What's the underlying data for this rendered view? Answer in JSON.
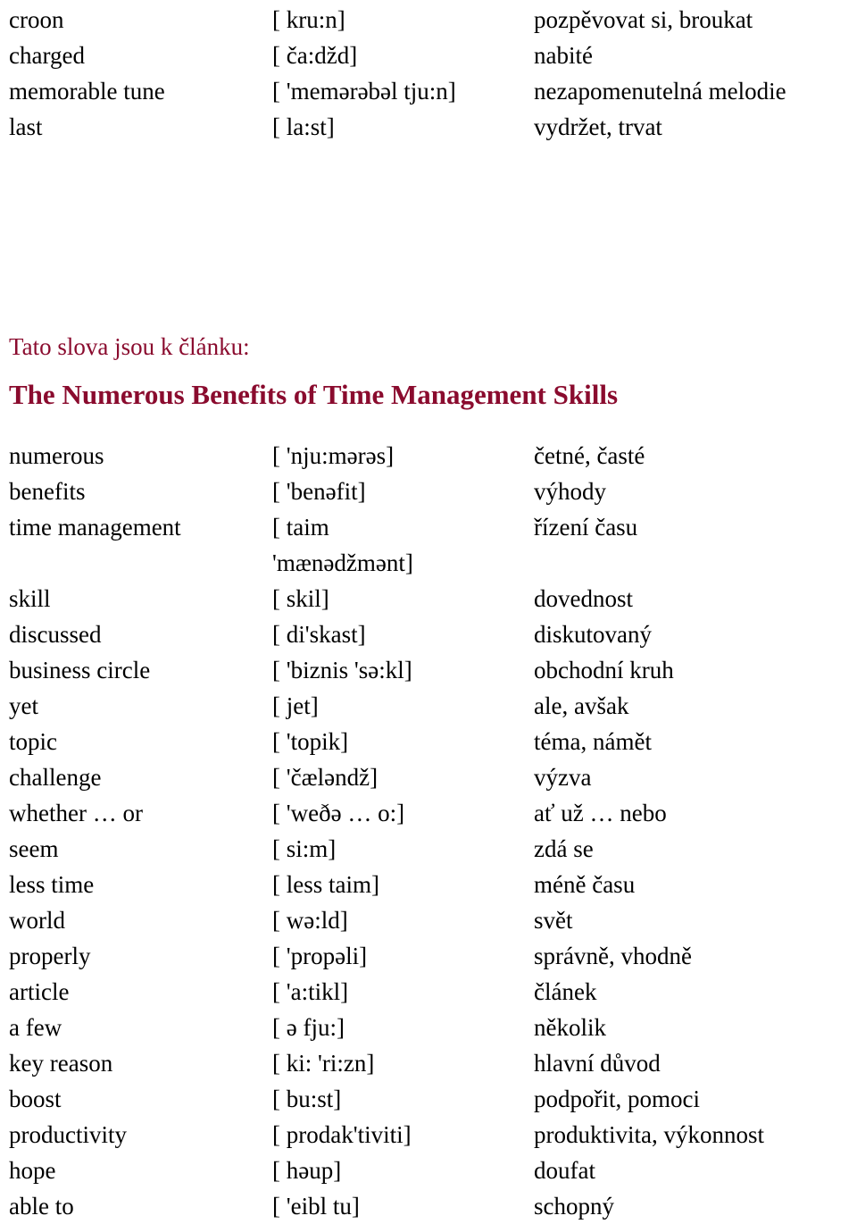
{
  "document": {
    "kind": "vocabulary-word-list",
    "heading_color": "#8a0b2e",
    "body_color": "#000000",
    "background_color": "#ffffff"
  },
  "top_block": {
    "rows": [
      {
        "term": "croon",
        "ipa": "[ kru:n]",
        "translation": "pozpěvovat si, broukat"
      },
      {
        "term": "charged",
        "ipa": "[ ča:džd]",
        "translation": "nabité"
      },
      {
        "term": "memorable tune",
        "ipa": "[ 'memərəbəl tju:n]",
        "translation": "nezapomenutelná melodie"
      },
      {
        "term": "last",
        "ipa": "[ la:st]",
        "translation": "vydržet, trvat"
      }
    ]
  },
  "intro": {
    "text": "Tato slova jsou k článku:"
  },
  "article_title": {
    "text": "The Numerous Benefits of Time Management Skills"
  },
  "main_block": {
    "rows": [
      {
        "term": "numerous",
        "ipa": "[ 'nju:mərəs]",
        "ipa_cont": "",
        "translation": "četné, časté"
      },
      {
        "term": "benefits",
        "ipa": "[ 'benəfit]",
        "ipa_cont": "",
        "translation": "výhody"
      },
      {
        "term": "time management",
        "ipa": "[ taim",
        "ipa_cont": "'mænədžmənt]",
        "translation": "řízení času"
      },
      {
        "term": "skill",
        "ipa": "[ skil]",
        "ipa_cont": "",
        "translation": "dovednost"
      },
      {
        "term": "discussed",
        "ipa": "[ di'skast]",
        "ipa_cont": "",
        "translation": "diskutovaný"
      },
      {
        "term": "business circle",
        "ipa": "[ 'biznis 'sə:kl]",
        "ipa_cont": "",
        "translation": "obchodní kruh"
      },
      {
        "term": "yet",
        "ipa": "[ jet]",
        "ipa_cont": "",
        "translation": "ale, avšak"
      },
      {
        "term": "topic",
        "ipa": "[ 'topik]",
        "ipa_cont": "",
        "translation": "téma, námět"
      },
      {
        "term": "challenge",
        "ipa": "[ 'čæləndž]",
        "ipa_cont": "",
        "translation": "výzva"
      },
      {
        "term": "whether … or",
        "ipa": "[ 'weðə … o:]",
        "ipa_cont": "",
        "translation": "ať už … nebo"
      },
      {
        "term": "seem",
        "ipa": "[ si:m]",
        "ipa_cont": "",
        "translation": "zdá se"
      },
      {
        "term": "less time",
        "ipa": "[ less taim]",
        "ipa_cont": "",
        "translation": "méně času"
      },
      {
        "term": "world",
        "ipa": "[ wə:ld]",
        "ipa_cont": "",
        "translation": "svět"
      },
      {
        "term": "properly",
        "ipa": "[ 'propəli]",
        "ipa_cont": "",
        "translation": "správně, vhodně"
      },
      {
        "term": "article",
        "ipa": "[ 'a:tikl]",
        "ipa_cont": "",
        "translation": "článek"
      },
      {
        "term": "a few",
        "ipa": "[ ə fju:]",
        "ipa_cont": "",
        "translation": "několik"
      },
      {
        "term": "key reason",
        "ipa": "[ ki: 'ri:zn]",
        "ipa_cont": "",
        "translation": "hlavní důvod"
      },
      {
        "term": "boost",
        "ipa": "[ bu:st]",
        "ipa_cont": "",
        "translation": "podpořit, pomoci"
      },
      {
        "term": "productivity",
        "ipa": "[ prodak'tiviti]",
        "ipa_cont": "",
        "translation": "produktivita, výkonnost"
      },
      {
        "term": "hope",
        "ipa": "[ həup]",
        "ipa_cont": "",
        "translation": "doufat"
      },
      {
        "term": "able to",
        "ipa": "[ 'eibl tu]",
        "ipa_cont": "",
        "translation": "schopný"
      }
    ]
  }
}
